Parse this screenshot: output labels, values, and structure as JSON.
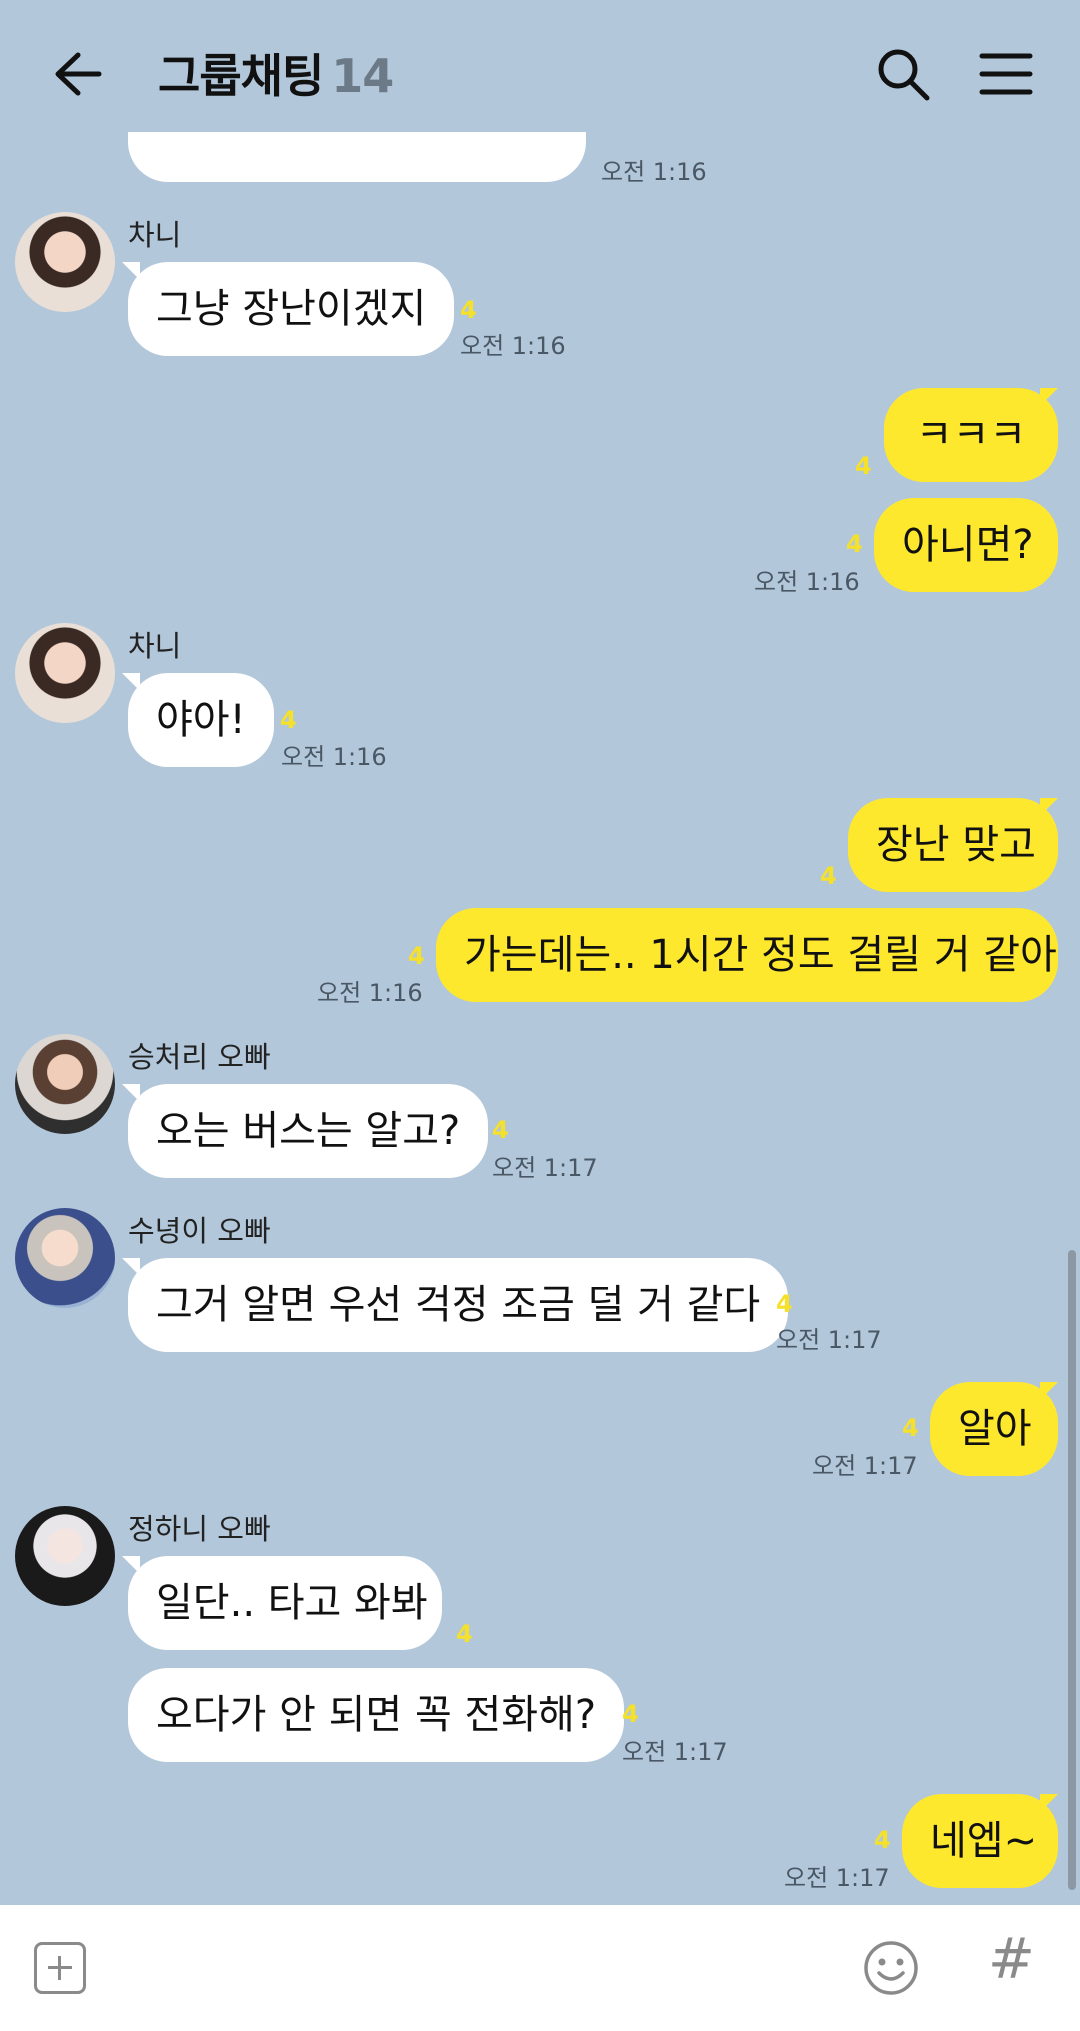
{
  "header": {
    "title": "그룹채팅",
    "member_count": "14",
    "back_icon": "arrow-left-icon",
    "search_icon": "search-icon",
    "menu_icon": "hamburger-menu-icon"
  },
  "messages": [
    {
      "id": "m0",
      "direction": "in",
      "text": "",
      "time": "오전 1:16"
    },
    {
      "id": "m1",
      "direction": "in",
      "sender": "차니",
      "text": "그냥 장난이겠지",
      "unread": "4",
      "time": "오전 1:16"
    },
    {
      "id": "m2",
      "direction": "out",
      "text": "ㅋㅋㅋ",
      "unread": "4"
    },
    {
      "id": "m3",
      "direction": "out",
      "text": "아니면?",
      "unread": "4",
      "time": "오전 1:16"
    },
    {
      "id": "m4",
      "direction": "in",
      "sender": "차니",
      "text": "야아!",
      "unread": "4",
      "time": "오전 1:16"
    },
    {
      "id": "m5",
      "direction": "out",
      "text": "장난 맞고",
      "unread": "4"
    },
    {
      "id": "m6",
      "direction": "out",
      "text": "가는데는.. 1시간 정도 걸릴 거 같아",
      "unread": "4",
      "time": "오전 1:16"
    },
    {
      "id": "m7",
      "direction": "in",
      "sender": "승처리 오빠",
      "text": "오는 버스는 알고?",
      "unread": "4",
      "time": "오전 1:17"
    },
    {
      "id": "m8",
      "direction": "in",
      "sender": "수녕이 오빠",
      "text": "그거 알면 우선 걱정 조금 덜 거 같다",
      "unread": "4",
      "time": "오전 1:17"
    },
    {
      "id": "m9",
      "direction": "out",
      "text": "알아",
      "unread": "4",
      "time": "오전 1:17"
    },
    {
      "id": "m10",
      "direction": "in",
      "sender": "정하니 오빠",
      "text": "일단.. 타고 와봐",
      "unread": "4"
    },
    {
      "id": "m11",
      "direction": "in",
      "text": "오다가 안 되면 꼭 전화해?",
      "unread": "4",
      "time": "오전 1:17"
    },
    {
      "id": "m12",
      "direction": "out",
      "text": "네엡~",
      "unread": "4",
      "time": "오전 1:17"
    }
  ],
  "input_bar": {
    "add_icon": "plus-square-icon",
    "emoji_icon": "emoji-icon",
    "hash_label": "#"
  },
  "colors": {
    "background": "#b2c7da",
    "outgoing_bubble": "#fee82d",
    "incoming_bubble": "#ffffff",
    "unread_count": "#f5e12a"
  }
}
